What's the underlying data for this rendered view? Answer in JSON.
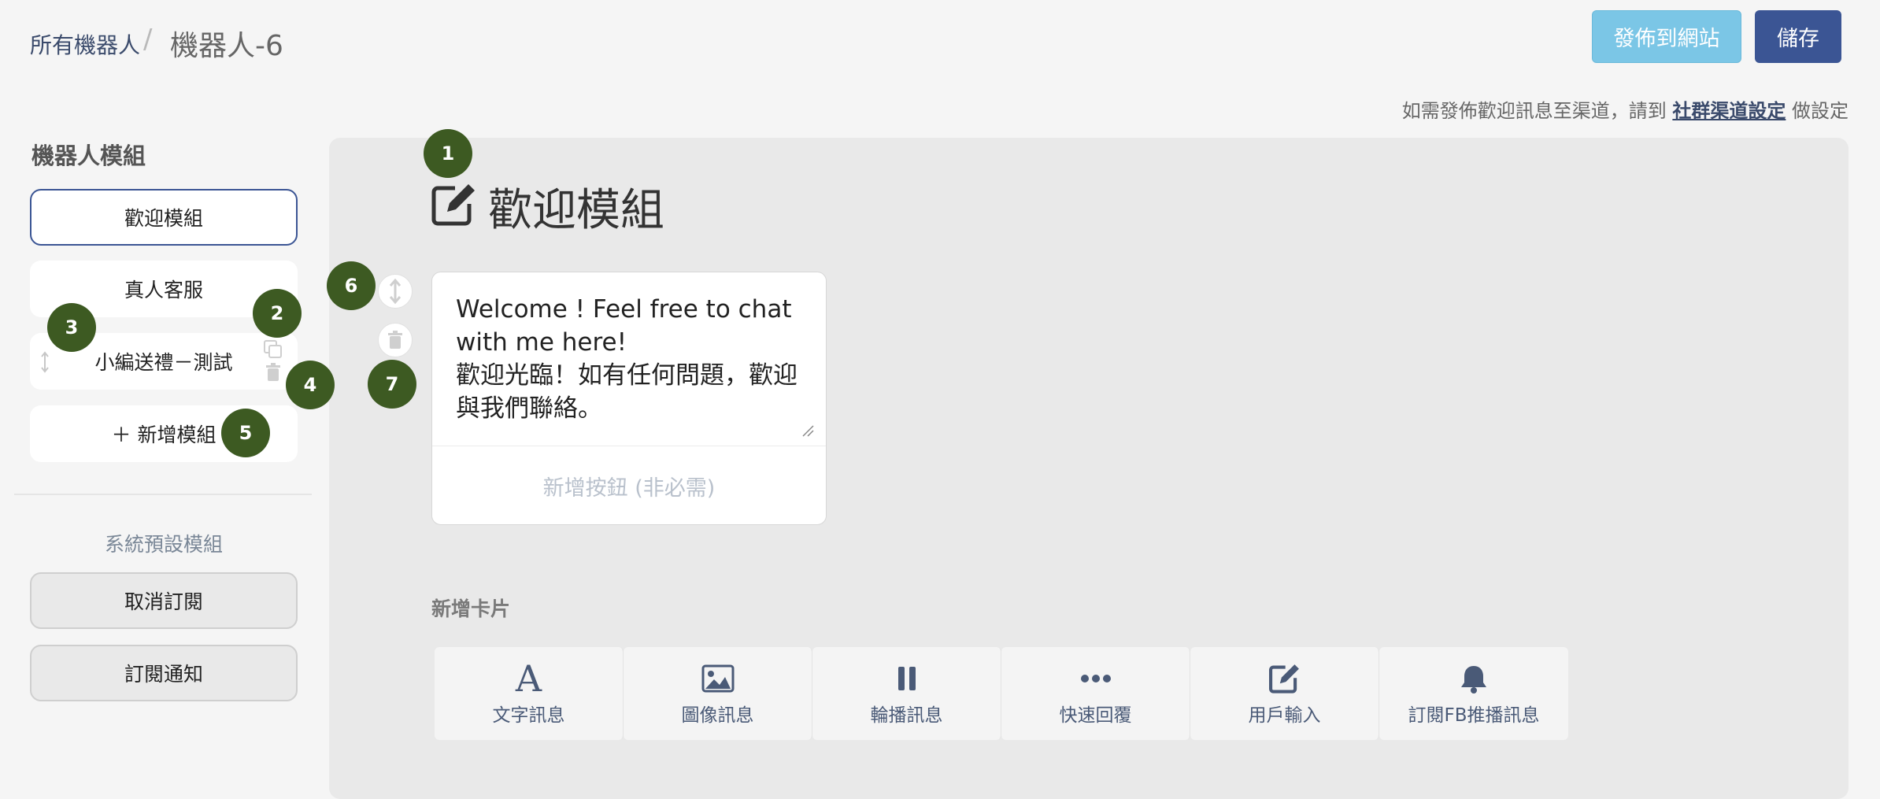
{
  "header": {
    "breadcrumb_link": "所有機器人",
    "breadcrumb_sep": "/",
    "title": "機器人-6",
    "publish_label": "發佈到網站",
    "save_label": "儲存"
  },
  "notice": {
    "prefix": "如需發佈歡迎訊息至渠道，請到",
    "link": "社群渠道設定",
    "suffix": "做設定"
  },
  "sidebar": {
    "title": "機器人模組",
    "modules": [
      "歡迎模組",
      "真人客服",
      "小編送禮－測試"
    ],
    "add_label": "＋ 新增模組",
    "system_title": "系統預設模組",
    "system_modules": [
      "取消訂閱",
      "訂閱通知"
    ]
  },
  "main": {
    "title": "歡迎模組",
    "card_text_line1": "Welcome ! Feel free to chat with me here!",
    "card_text_line2": "歡迎光臨！如有任何問題，歡迎與我們聯絡。",
    "add_button_placeholder": "新增按鈕 (非必需)",
    "add_card_title": "新增卡片",
    "tools": [
      "文字訊息",
      "圖像訊息",
      "輪播訊息",
      "快速回覆",
      "用戶輸入",
      "訂閱FB推播訊息"
    ]
  },
  "markers": [
    "1",
    "2",
    "3",
    "4",
    "5",
    "6",
    "7"
  ],
  "colors": {
    "primary": "#3b5594",
    "publish": "#7bc6e6",
    "marker": "#3d5a22",
    "panel": "#e9e9e9"
  }
}
